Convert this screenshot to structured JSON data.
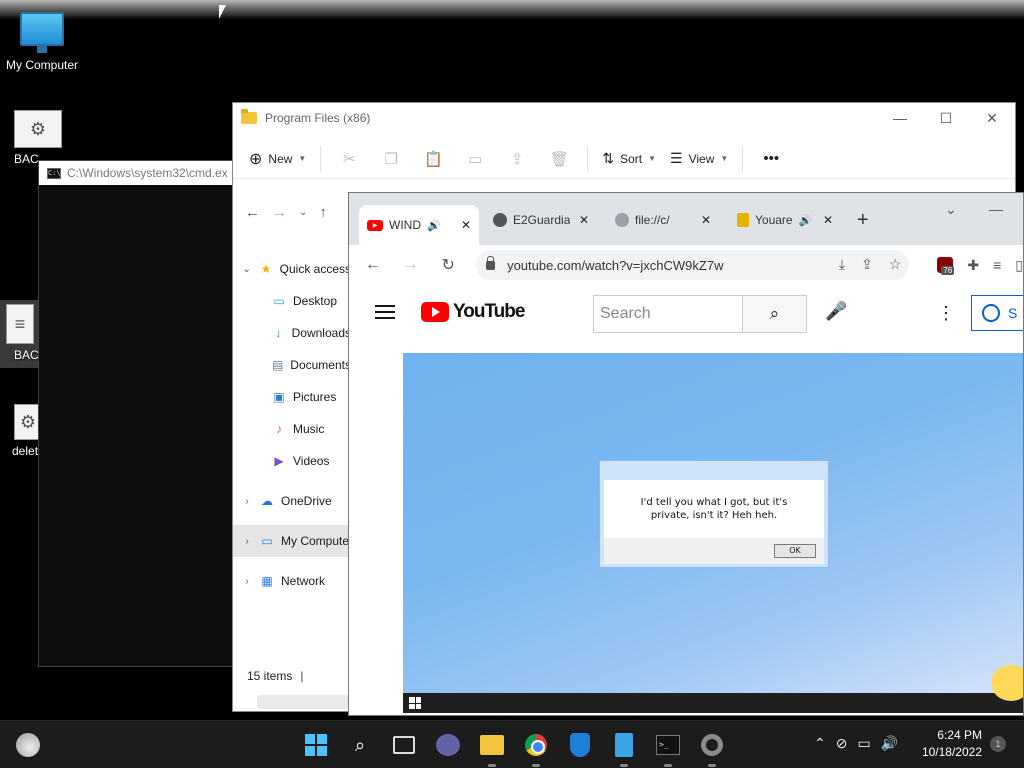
{
  "desktop": {
    "icons": [
      {
        "label": "My Computer"
      },
      {
        "label": "BAC"
      },
      {
        "label": "BAC"
      },
      {
        "label": "delet"
      }
    ]
  },
  "cmd": {
    "title": "C:\\Windows\\system32\\cmd.ex"
  },
  "explorer": {
    "title": "Program Files (x86)",
    "toolbar": {
      "new_label": "New",
      "sort_label": "Sort",
      "view_label": "View"
    },
    "sidebar": {
      "quick_access": "Quick access",
      "quick_items": [
        {
          "label": "Desktop",
          "icon": "desktop-icon"
        },
        {
          "label": "Downloads",
          "icon": "download-icon"
        },
        {
          "label": "Documents",
          "icon": "document-icon"
        },
        {
          "label": "Pictures",
          "icon": "picture-icon"
        },
        {
          "label": "Music",
          "icon": "music-icon"
        },
        {
          "label": "Videos",
          "icon": "video-icon"
        }
      ],
      "onedrive": "OneDrive",
      "my_computer": "My Compute",
      "network": "Network"
    },
    "status": {
      "items": "15 items"
    }
  },
  "browser": {
    "tabs": [
      {
        "title": "WIND",
        "favicon": "youtube",
        "audio": true,
        "active": true
      },
      {
        "title": "E2Guardia",
        "favicon": "globe",
        "audio": false,
        "active": false
      },
      {
        "title": "file://c/",
        "favicon": "globe-light",
        "audio": false,
        "active": false
      },
      {
        "title": "Youare",
        "favicon": "square",
        "audio": true,
        "active": false
      }
    ],
    "url": "youtube.com/watch?v=jxchCW9kZ7w",
    "extension_badge": "76",
    "youtube": {
      "logo_text": "YouTube",
      "search_placeholder": "Search",
      "signin_label": "S"
    },
    "video": {
      "dialog_text": "I'd tell you what I got, but it's private, isn't it? Heh heh.",
      "dialog_button": "OK"
    }
  },
  "taskbar": {
    "time": "6:24 PM",
    "date": "10/18/2022",
    "notifications": "1"
  },
  "colors": {
    "accent": "#065fd4",
    "youtube_red": "#ff0000",
    "taskbar_bg": "#1c1c1c"
  }
}
